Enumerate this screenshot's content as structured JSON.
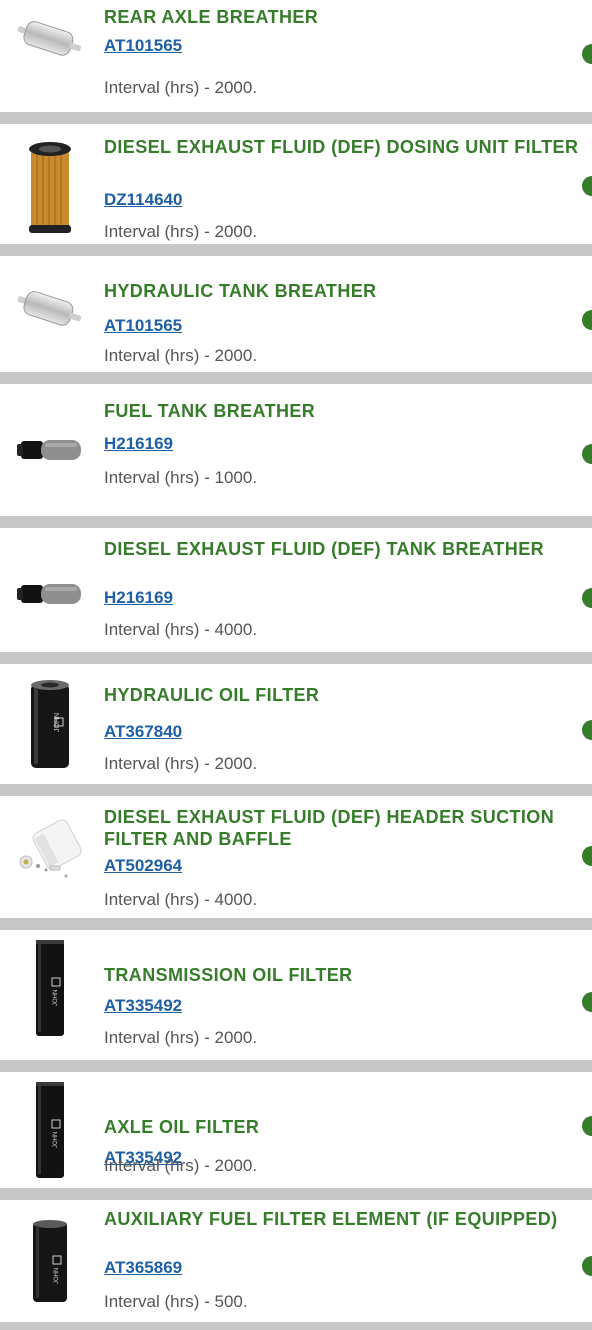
{
  "items": [
    {
      "name": "REAR AXLE BREATHER",
      "part": "AT101565",
      "interval": "Interval (hrs) - 2000.",
      "image": "breather-filter-icon"
    },
    {
      "name": "DIESEL EXHAUST FLUID (DEF) DOSING UNIT FILTER",
      "part": "DZ114640",
      "interval": "Interval (hrs) - 2000.",
      "image": "pleated-filter-element-icon"
    },
    {
      "name": "HYDRAULIC TANK BREATHER",
      "part": "AT101565",
      "interval": "Interval (hrs) - 2000.",
      "image": "breather-filter-icon"
    },
    {
      "name": "FUEL TANK BREATHER",
      "part": "H216169",
      "interval": "Interval (hrs) - 1000.",
      "image": "tank-breather-plug-icon"
    },
    {
      "name": "DIESEL EXHAUST FLUID (DEF) TANK BREATHER",
      "part": "H216169",
      "interval": "Interval (hrs) - 4000.",
      "image": "tank-breather-plug-icon"
    },
    {
      "name": "HYDRAULIC OIL FILTER",
      "part": "AT367840",
      "interval": "Interval (hrs) - 2000.",
      "image": "spin-on-filter-icon"
    },
    {
      "name": "DIESEL EXHAUST FLUID (DEF) HEADER SUCTION FILTER AND BAFFLE",
      "part": "AT502964",
      "interval": "Interval (hrs) - 4000.",
      "image": "suction-filter-baffle-icon"
    },
    {
      "name": "TRANSMISSION OIL FILTER",
      "part": "AT335492",
      "interval": "Interval (hrs) - 2000.",
      "image": "tall-spin-on-filter-icon"
    },
    {
      "name": "AXLE OIL FILTER",
      "part": "AT335492",
      "interval": "Interval (hrs) - 2000.",
      "image": "tall-spin-on-filter-icon"
    },
    {
      "name": "AUXILIARY FUEL FILTER ELEMENT (IF EQUIPPED)",
      "part": "AT365869",
      "interval": "Interval (hrs) - 500.",
      "image": "spin-on-filter-icon"
    }
  ],
  "colors": {
    "title_green": "#367c2b",
    "link_blue": "#1f5fa6",
    "separator_gray": "#c8c8c8",
    "text_gray": "#555555"
  }
}
